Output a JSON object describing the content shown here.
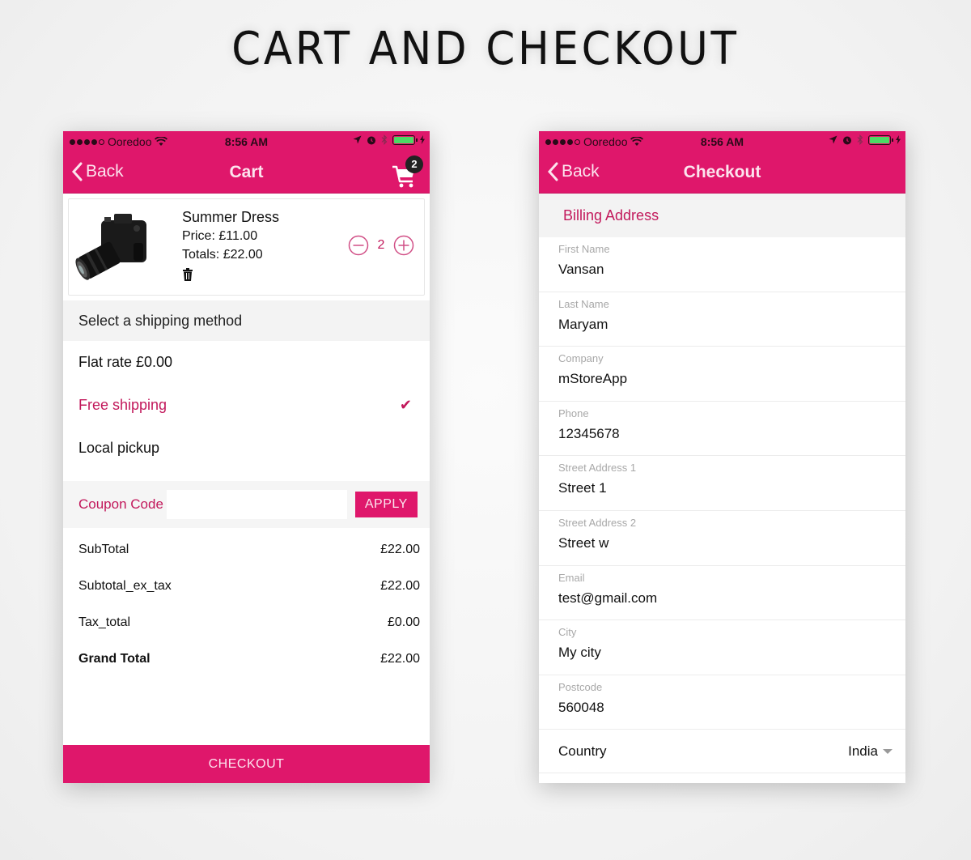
{
  "page": {
    "title": "CART AND CHECKOUT"
  },
  "status_bar": {
    "carrier": "Ooredoo",
    "time": "8:56 AM",
    "signal_bars_filled": 4,
    "signal_bars_total": 5,
    "battery_level": 1.0
  },
  "colors": {
    "brand": "#df176b",
    "accent_text": "#c2185b",
    "battery": "#4cd964"
  },
  "cart": {
    "nav": {
      "back_label": "Back",
      "title": "Cart",
      "cart_count": "2"
    },
    "product": {
      "name": "Summer Dress",
      "price": "Price: £11.00",
      "totals": "Totals: £22.00",
      "quantity": "2",
      "image_icon": "camera-product-image"
    },
    "shipping": {
      "header": "Select a shipping method",
      "options": [
        {
          "label": "Flat rate £0.00",
          "selected": false
        },
        {
          "label": "Free shipping",
          "selected": true
        },
        {
          "label": "Local pickup",
          "selected": false
        }
      ],
      "check_glyph": "✔"
    },
    "coupon": {
      "label": "Coupon Code",
      "value": "",
      "placeholder": "",
      "apply_label": "APPLY"
    },
    "totals": [
      {
        "label": "SubTotal",
        "value": "£22.00"
      },
      {
        "label": "Subtotal_ex_tax",
        "value": "£22.00"
      },
      {
        "label": "Tax_total",
        "value": "£0.00"
      },
      {
        "label": "Grand Total",
        "value": "£22.00"
      }
    ],
    "checkout_label": "CHECKOUT"
  },
  "checkout": {
    "nav": {
      "back_label": "Back",
      "title": "Checkout"
    },
    "billing_header": "Billing Address",
    "fields": [
      {
        "label": "First Name",
        "value": "Vansan"
      },
      {
        "label": "Last Name",
        "value": "Maryam"
      },
      {
        "label": "Company",
        "value": "mStoreApp"
      },
      {
        "label": "Phone",
        "value": "12345678"
      },
      {
        "label": "Street Address 1",
        "value": "Street 1"
      },
      {
        "label": "Street Address 2",
        "value": "Street w"
      },
      {
        "label": "Email",
        "value": "test@gmail.com"
      },
      {
        "label": "City",
        "value": "My city"
      },
      {
        "label": "Postcode",
        "value": "560048"
      }
    ],
    "country": {
      "label": "Country",
      "value": "India"
    }
  }
}
